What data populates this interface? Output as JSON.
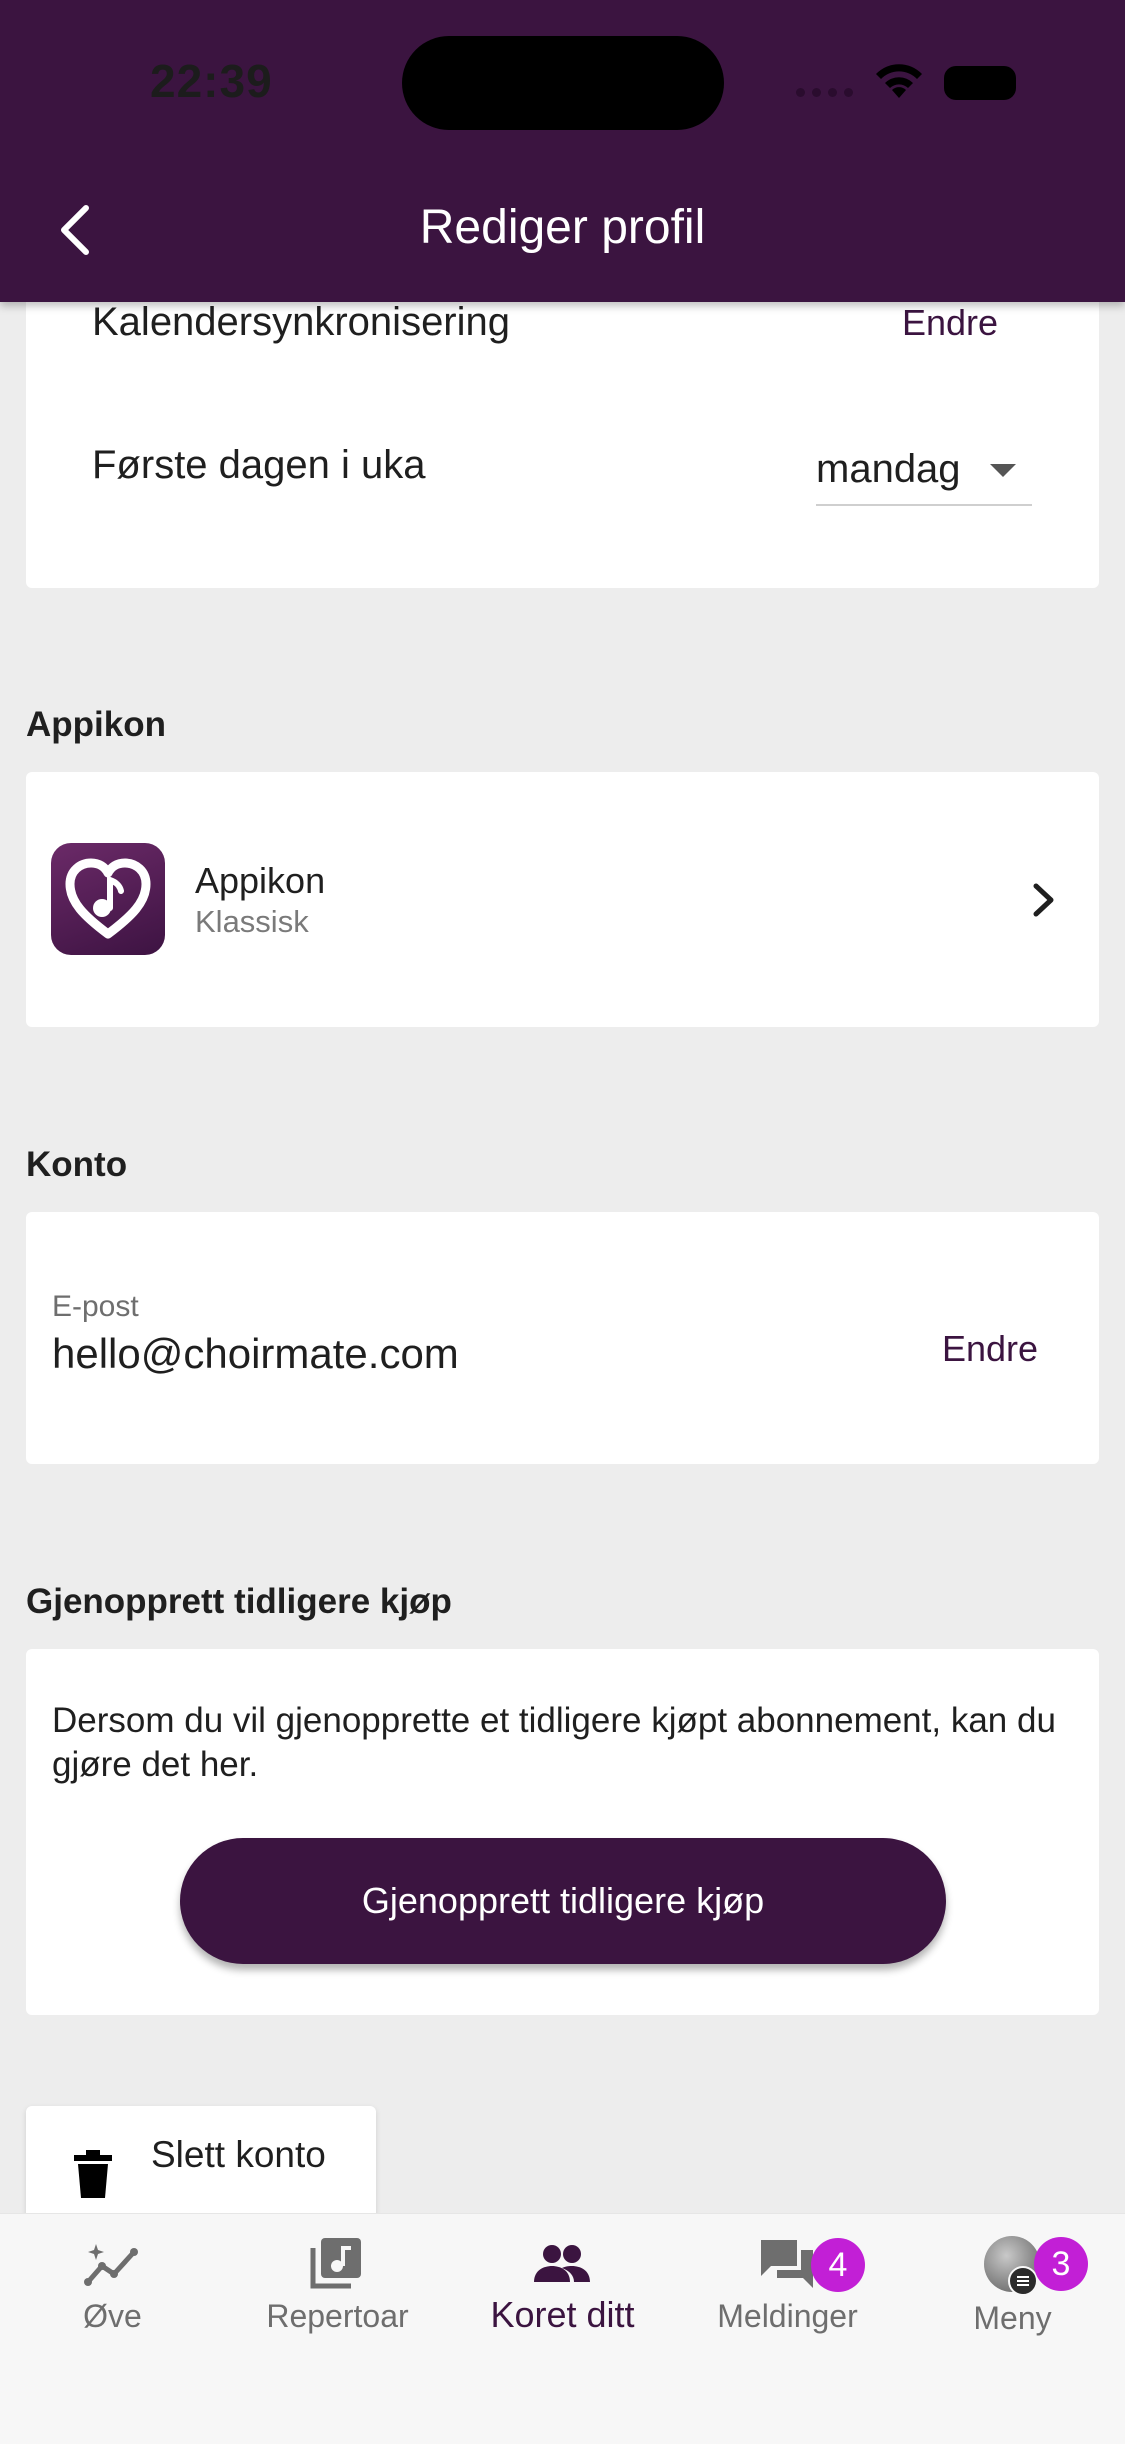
{
  "status_bar": {
    "time": "22:39"
  },
  "header": {
    "title": "Rediger profil"
  },
  "settings": {
    "calendar_sync_label": "Kalendersynkronisering",
    "calendar_sync_action": "Endre",
    "first_day_label": "Første dagen i uka",
    "first_day_value": "mandag"
  },
  "app_icon_section": {
    "title": "Appikon",
    "item_title": "Appikon",
    "item_subtitle": "Klassisk"
  },
  "account_section": {
    "title": "Konto",
    "email_label": "E-post",
    "email_value": "hello@choirmate.com",
    "email_action": "Endre"
  },
  "restore_section": {
    "title": "Gjenopprett tidligere kjøp",
    "description": "Dersom du vil gjenopprette et tidligere kjøpt abonnement, kan du gjøre det her.",
    "button_label": "Gjenopprett tidligere kjøp"
  },
  "delete_account": {
    "label": "Slett konto"
  },
  "bottom_nav": {
    "items": [
      {
        "label": "Øve",
        "icon": "chart-icon"
      },
      {
        "label": "Repertoar",
        "icon": "music-library-icon"
      },
      {
        "label": "Koret ditt",
        "icon": "group-icon"
      },
      {
        "label": "Meldinger",
        "icon": "chat-icon",
        "badge": "4"
      },
      {
        "label": "Meny",
        "icon": "avatar",
        "badge": "3"
      }
    ],
    "active_index": 2
  },
  "colors": {
    "brand": "#3b1440",
    "badge": "#c21fd6",
    "background": "#ededed"
  }
}
